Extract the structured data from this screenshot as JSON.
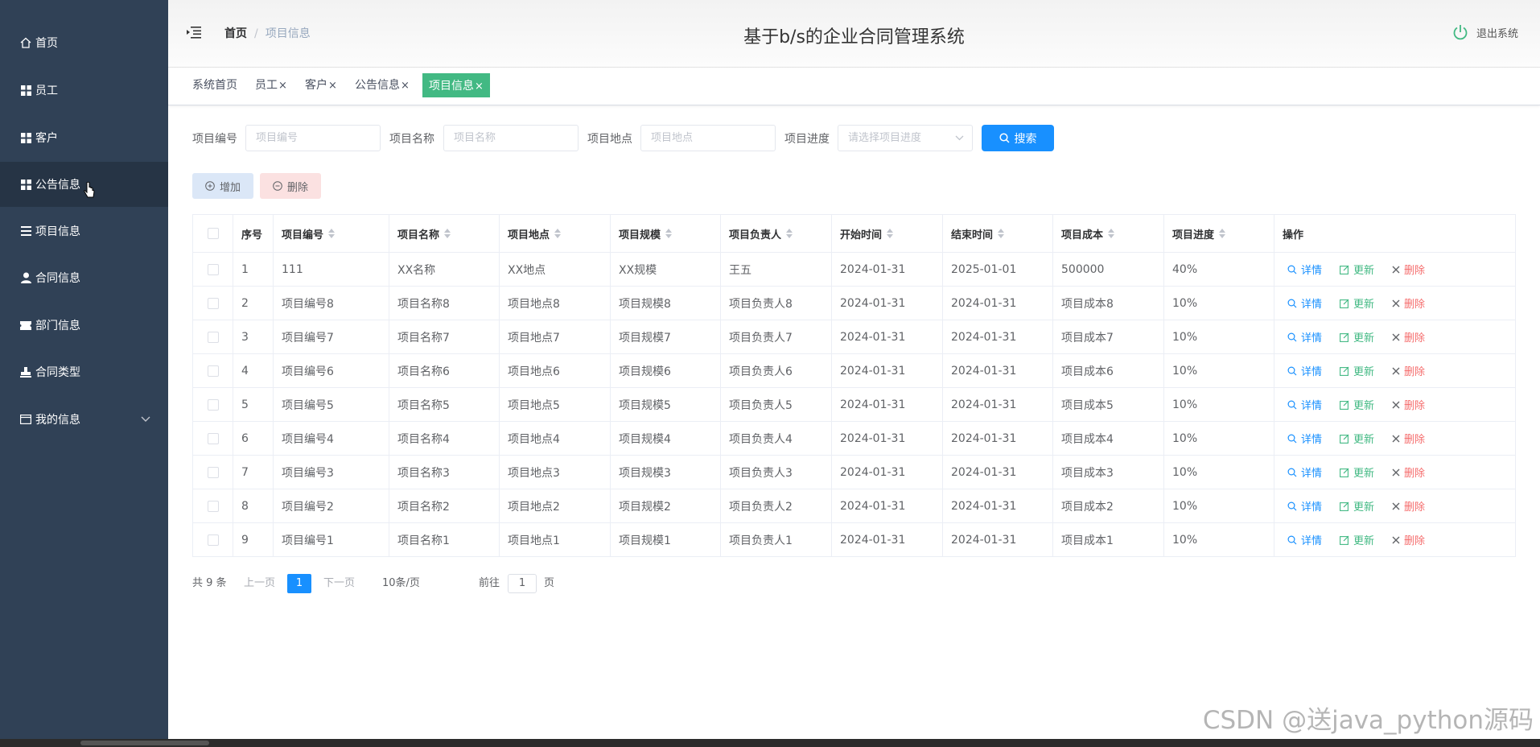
{
  "app": {
    "title": "基于b/s的企业合同管理系统",
    "logout_label": "退出系统"
  },
  "breadcrumb": {
    "home": "首页",
    "separator": "/",
    "current": "项目信息"
  },
  "sidebar": {
    "items": [
      {
        "label": "首页",
        "icon": "home-icon"
      },
      {
        "label": "员工",
        "icon": "grid-icon"
      },
      {
        "label": "客户",
        "icon": "grid-icon"
      },
      {
        "label": "公告信息",
        "icon": "grid-icon"
      },
      {
        "label": "项目信息",
        "icon": "list-icon"
      },
      {
        "label": "合同信息",
        "icon": "user-icon"
      },
      {
        "label": "部门信息",
        "icon": "ticket-icon"
      },
      {
        "label": "合同类型",
        "icon": "stamp-icon"
      },
      {
        "label": "我的信息",
        "icon": "id-card-icon"
      }
    ]
  },
  "tags": [
    {
      "label": "系统首页",
      "closable": false,
      "active": false
    },
    {
      "label": "员工",
      "closable": true,
      "active": false
    },
    {
      "label": "客户",
      "closable": true,
      "active": false
    },
    {
      "label": "公告信息",
      "closable": true,
      "active": false
    },
    {
      "label": "项目信息",
      "closable": true,
      "active": true
    }
  ],
  "tag_close": "×",
  "search": {
    "fields": [
      {
        "label": "项目编号",
        "placeholder": "项目编号"
      },
      {
        "label": "项目名称",
        "placeholder": "项目名称"
      },
      {
        "label": "项目地点",
        "placeholder": "项目地点"
      },
      {
        "label": "项目进度",
        "placeholder": "请选择项目进度"
      }
    ],
    "button_label": "搜索"
  },
  "toolbar": {
    "add_label": "增加",
    "delete_label": "删除"
  },
  "table": {
    "columns": [
      "序号",
      "项目编号",
      "项目名称",
      "项目地点",
      "项目规模",
      "项目负责人",
      "开始时间",
      "结束时间",
      "项目成本",
      "项目进度",
      "操作"
    ],
    "rows": [
      [
        "1",
        "111",
        "XX名称",
        "XX地点",
        "XX规模",
        "王五",
        "2024-01-31",
        "2025-01-01",
        "500000",
        "40%"
      ],
      [
        "2",
        "项目编号8",
        "项目名称8",
        "项目地点8",
        "项目规模8",
        "项目负责人8",
        "2024-01-31",
        "2024-01-31",
        "项目成本8",
        "10%"
      ],
      [
        "3",
        "项目编号7",
        "项目名称7",
        "项目地点7",
        "项目规模7",
        "项目负责人7",
        "2024-01-31",
        "2024-01-31",
        "项目成本7",
        "10%"
      ],
      [
        "4",
        "项目编号6",
        "项目名称6",
        "项目地点6",
        "项目规模6",
        "项目负责人6",
        "2024-01-31",
        "2024-01-31",
        "项目成本6",
        "10%"
      ],
      [
        "5",
        "项目编号5",
        "项目名称5",
        "项目地点5",
        "项目规模5",
        "项目负责人5",
        "2024-01-31",
        "2024-01-31",
        "项目成本5",
        "10%"
      ],
      [
        "6",
        "项目编号4",
        "项目名称4",
        "项目地点4",
        "项目规模4",
        "项目负责人4",
        "2024-01-31",
        "2024-01-31",
        "项目成本4",
        "10%"
      ],
      [
        "7",
        "项目编号3",
        "项目名称3",
        "项目地点3",
        "项目规模3",
        "项目负责人3",
        "2024-01-31",
        "2024-01-31",
        "项目成本3",
        "10%"
      ],
      [
        "8",
        "项目编号2",
        "项目名称2",
        "项目地点2",
        "项目规模2",
        "项目负责人2",
        "2024-01-31",
        "2024-01-31",
        "项目成本2",
        "10%"
      ],
      [
        "9",
        "项目编号1",
        "项目名称1",
        "项目地点1",
        "项目规模1",
        "项目负责人1",
        "2024-01-31",
        "2024-01-31",
        "项目成本1",
        "10%"
      ]
    ],
    "actions": {
      "detail": "详情",
      "update": "更新",
      "remove": "删除"
    }
  },
  "pagination": {
    "total": "共 9 条",
    "prev": "上一页",
    "current": "1",
    "next": "下一页",
    "page_size": "10条/页",
    "goto_prefix": "前往",
    "goto_value": "1",
    "goto_suffix": "页"
  },
  "watermark": "CSDN @送java_python源码",
  "colors": {
    "sidebar": "#304156",
    "primary": "#1890ff",
    "success": "#42b983",
    "danger": "#f56c6c"
  }
}
